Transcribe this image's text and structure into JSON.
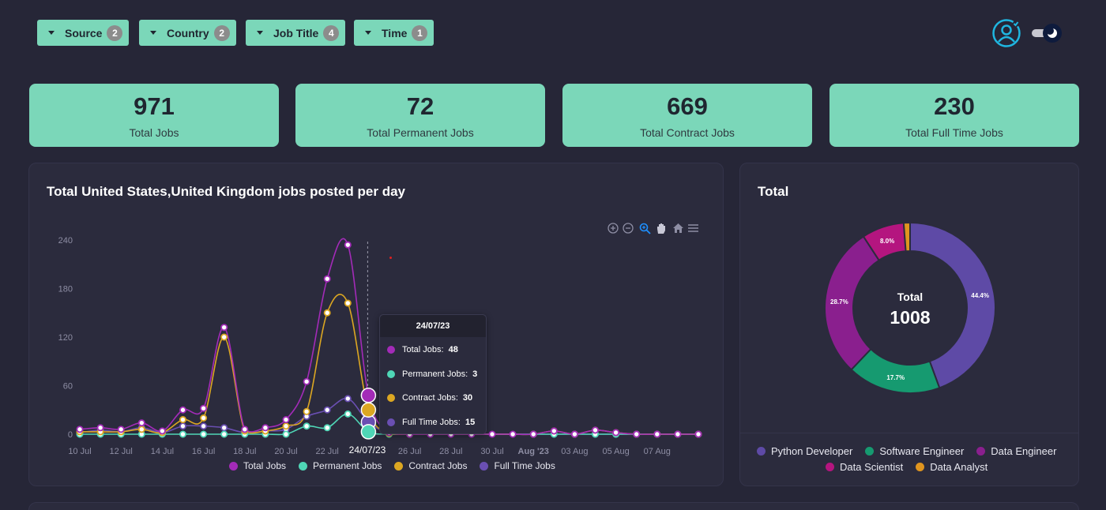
{
  "filters": [
    {
      "label": "Source",
      "count": "2"
    },
    {
      "label": "Country",
      "count": "2"
    },
    {
      "label": "Job Title",
      "count": "4"
    },
    {
      "label": "Time",
      "count": "1"
    }
  ],
  "kpis": [
    {
      "value": "971",
      "label": "Total Jobs"
    },
    {
      "value": "72",
      "label": "Total Permanent Jobs"
    },
    {
      "value": "669",
      "label": "Total Contract Jobs"
    },
    {
      "value": "230",
      "label": "Total Full Time Jobs"
    }
  ],
  "line_panel": {
    "title": "Total United States,United Kingdom jobs posted per day",
    "toolbar_icons": [
      "zoom-in-icon",
      "zoom-out-icon",
      "zoom-selection-icon",
      "pan-hand-icon",
      "reset-home-icon",
      "menu-icon"
    ],
    "tooltip": {
      "date": "24/07/23",
      "rows": [
        {
          "label": "Total Jobs:",
          "value": "48",
          "color": "#a32bb8"
        },
        {
          "label": "Permanent Jobs:",
          "value": "3",
          "color": "#4fd6b6"
        },
        {
          "label": "Contract Jobs:",
          "value": "30",
          "color": "#dca722"
        },
        {
          "label": "Full Time Jobs:",
          "value": "15",
          "color": "#6a4fb2"
        }
      ]
    },
    "x_tooltip": "24/07/23"
  },
  "donut_panel": {
    "title": "Total",
    "center_label": "Total",
    "center_value": "1008"
  },
  "chart_data": [
    {
      "type": "line",
      "title": "Total United States,United Kingdom jobs posted per day",
      "ylim": [
        0,
        240
      ],
      "yticks": [
        "0",
        "60",
        "120",
        "180",
        "240"
      ],
      "x_tick_labels": [
        "10 Jul",
        "12 Jul",
        "14 Jul",
        "16 Jul",
        "18 Jul",
        "20 Jul",
        "22 Jul",
        "24/07/23",
        "26 Jul",
        "28 Jul",
        "30 Jul",
        "Aug '23",
        "03 Aug",
        "05 Aug",
        "07 Aug"
      ],
      "x": [
        "10 Jul",
        "11 Jul",
        "12 Jul",
        "13 Jul",
        "14 Jul",
        "15 Jul",
        "16 Jul",
        "17 Jul",
        "18 Jul",
        "19 Jul",
        "20 Jul",
        "21 Jul",
        "22 Jul",
        "23 Jul",
        "24 Jul",
        "25 Jul",
        "26 Jul",
        "27 Jul",
        "28 Jul",
        "29 Jul",
        "30 Jul",
        "31 Jul",
        "01 Aug",
        "02 Aug",
        "03 Aug",
        "04 Aug",
        "05 Aug",
        "06 Aug",
        "07 Aug",
        "08 Aug",
        "09 Aug"
      ],
      "series": [
        {
          "name": "Total Jobs",
          "color": "#a32bb8",
          "values": [
            6,
            8,
            6,
            14,
            4,
            30,
            32,
            132,
            6,
            8,
            18,
            65,
            192,
            234,
            48,
            2,
            0,
            0,
            0,
            0,
            0,
            0,
            0,
            4,
            0,
            5,
            2,
            0,
            0,
            0,
            0
          ]
        },
        {
          "name": "Permanent Jobs",
          "color": "#4fd6b6",
          "values": [
            0,
            0,
            0,
            0,
            0,
            0,
            0,
            0,
            0,
            0,
            0,
            10,
            8,
            25,
            3,
            0,
            0,
            0,
            0,
            0,
            0,
            0,
            0,
            0,
            0,
            0,
            0,
            0,
            0,
            0,
            0
          ]
        },
        {
          "name": "Contract Jobs",
          "color": "#dca722",
          "values": [
            3,
            3,
            3,
            6,
            2,
            18,
            20,
            120,
            4,
            4,
            10,
            28,
            150,
            162,
            30,
            1,
            0,
            0,
            0,
            0,
            0,
            0,
            0,
            4,
            0,
            5,
            2,
            0,
            0,
            0,
            0
          ]
        },
        {
          "name": "Full Time Jobs",
          "color": "#6a4fb2",
          "values": [
            2,
            5,
            3,
            8,
            2,
            10,
            10,
            8,
            2,
            4,
            6,
            22,
            30,
            44,
            15,
            1,
            0,
            0,
            0,
            0,
            0,
            0,
            0,
            0,
            0,
            0,
            0,
            0,
            0,
            0,
            0
          ]
        }
      ],
      "legend": [
        "Total Jobs",
        "Permanent Jobs",
        "Contract Jobs",
        "Full Time Jobs"
      ],
      "legend_placement": "bottom",
      "grid": false
    },
    {
      "type": "pie",
      "title": "Total",
      "total": 1008,
      "slices": [
        {
          "name": "Python Developer",
          "value": 44.4,
          "label": "44.4%",
          "color": "#5e4aa6"
        },
        {
          "name": "Software Engineer",
          "value": 17.7,
          "label": "17.7%",
          "color": "#169a70"
        },
        {
          "name": "Data Engineer",
          "value": 28.7,
          "label": "28.7%",
          "color": "#8a1f8e"
        },
        {
          "name": "Data Scientist",
          "value": 8.0,
          "label": "8.0%",
          "color": "#b4157f"
        },
        {
          "name": "Data Analyst",
          "value": 1.2,
          "label": "",
          "color": "#e0951f"
        }
      ],
      "legend_placement": "bottom"
    }
  ]
}
